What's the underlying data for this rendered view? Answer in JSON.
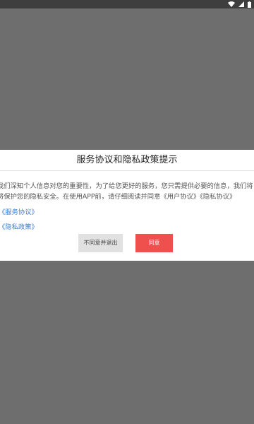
{
  "dialog": {
    "title": "服务协议和隐私政策提示",
    "body_line1": "我们深知个人信息对您的重要性，为了给您更好的服务，您只需提供必要的信息，我们将",
    "body_line2": "将保护您的隐私安全。在使用APP前，请仔细阅读并同意《用户协议》《隐私协议》",
    "link_service": "《服务协议》",
    "link_privacy": "《隐私政策》",
    "disagree_label": "不同意并退出",
    "agree_label": "同意"
  },
  "colors": {
    "overlay": "#6e6e6e",
    "statusbar": "#3e3e3e",
    "link": "#3a7bd5",
    "agree_button": "#ef4f4d",
    "disagree_button": "#e1e1e1"
  }
}
